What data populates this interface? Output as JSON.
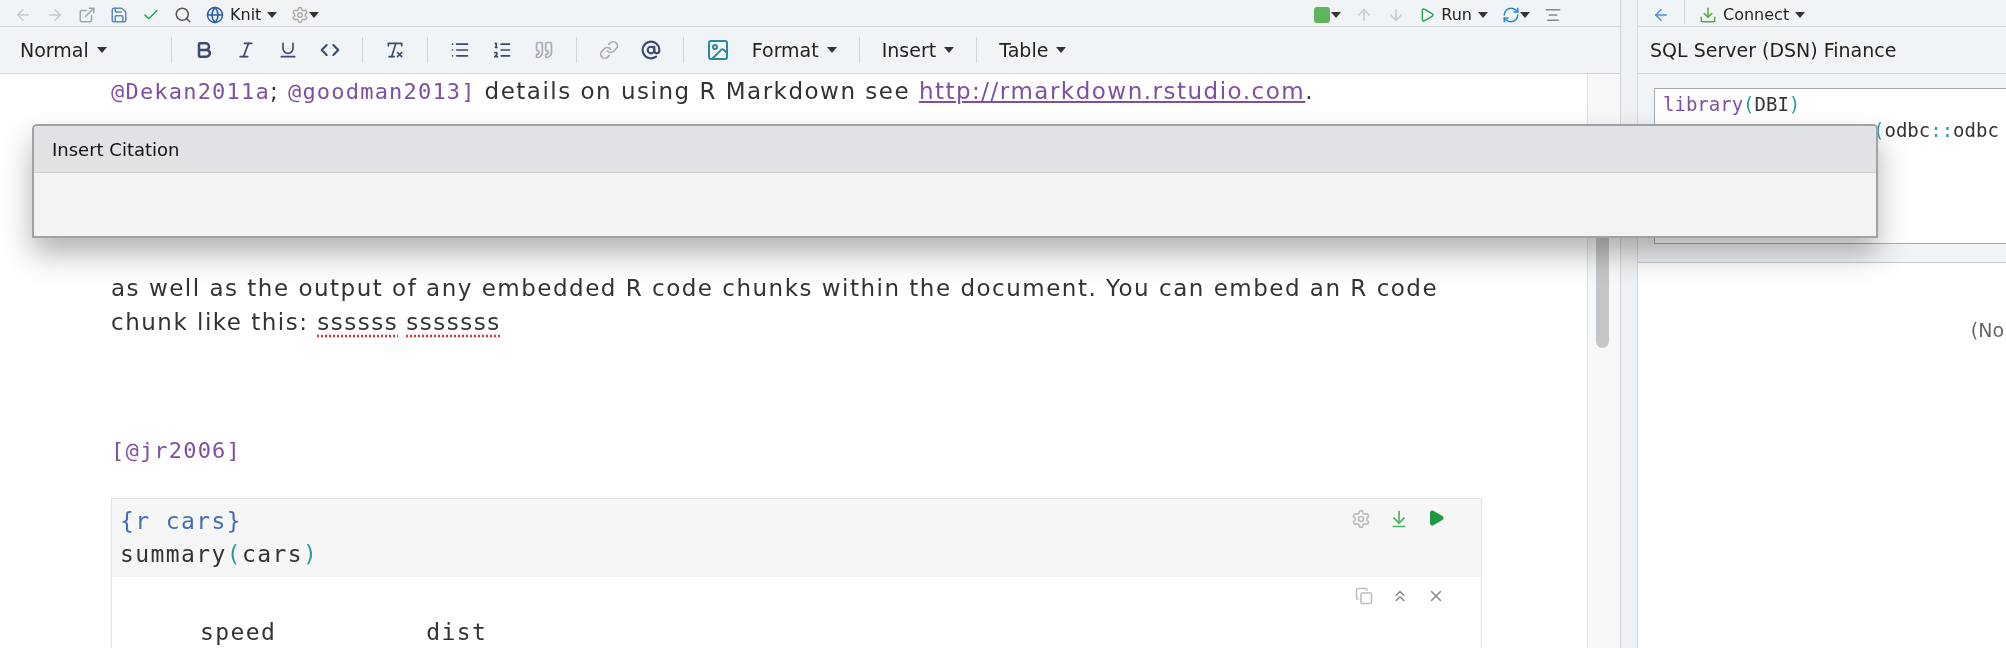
{
  "toolbar": {
    "knit_label": "Knit",
    "run_label": "Run",
    "style_menu": "Normal",
    "menus": [
      "Format",
      "Insert",
      "Table"
    ]
  },
  "editor": {
    "blocks": [
      {
        "kind": "text",
        "lines": [
          [
            {
              "kind": "cite",
              "text": "@Dekan2011a"
            },
            {
              "kind": "plain",
              "text": "; "
            },
            {
              "kind": "cite",
              "text": "@goodman2013]"
            },
            {
              "kind": "plain",
              "text": " details on using R Markdown see "
            },
            {
              "kind": "link",
              "text": "http://rmarkdown.rstudio.com"
            },
            {
              "kind": "plain",
              "text": "."
            }
          ]
        ]
      },
      {
        "kind": "text",
        "lines": [
          [
            {
              "kind": "plain",
              "text": "as well as the output of any embedded R code chunks within the document. You can embed an R code"
            }
          ],
          [
            {
              "kind": "plain",
              "text": "chunk like this: "
            },
            {
              "kind": "misspelled",
              "text": "ssssss"
            },
            {
              "kind": "misspelled",
              "text": "sssssss"
            }
          ]
        ]
      },
      {
        "kind": "text",
        "lines": [
          [
            {
              "kind": "cite",
              "text": "[@jr2006]"
            }
          ]
        ]
      },
      {
        "kind": "chunk",
        "header": "{r cars}",
        "code": [
          {
            "kind": "plain",
            "text": "summary"
          },
          {
            "kind": "paren",
            "text": "("
          },
          {
            "kind": "plain",
            "text": "cars"
          },
          {
            "kind": "paren",
            "text": ")"
          }
        ],
        "output": [
          "speed",
          "dist"
        ]
      }
    ]
  },
  "dialog": {
    "title": "Insert Citation"
  },
  "right_pane": {
    "connect_label": "Connect",
    "title": "SQL Server (DSN) Finance",
    "code": [
      [
        {
          "kind": "fn",
          "text": "library"
        },
        {
          "kind": "paren",
          "text": "("
        },
        {
          "kind": "plain",
          "text": "DBI"
        },
        {
          "kind": "paren",
          "text": ")"
        }
      ],
      [
        {
          "kind": "paren",
          "text": "("
        },
        {
          "kind": "plain",
          "text": "odbc"
        },
        {
          "kind": "paren",
          "text": "::"
        },
        {
          "kind": "plain",
          "text": "odbc"
        }
      ]
    ],
    "note": "(No"
  }
}
